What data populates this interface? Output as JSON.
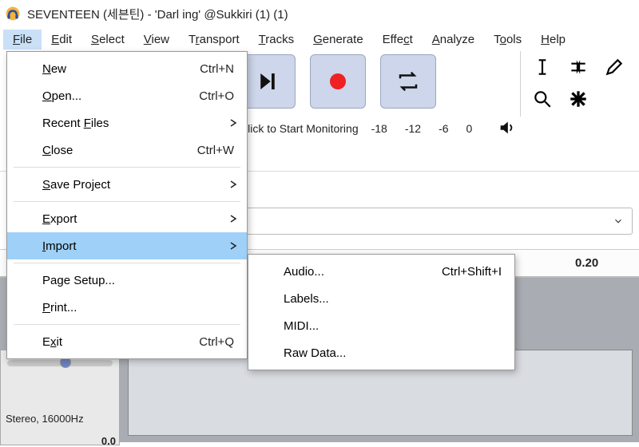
{
  "titlebar": {
    "title": "SEVENTEEN (세븐틴) - 'Darl ing' @Sukkiri (1) (1)"
  },
  "menubar": {
    "file": "File",
    "edit": "Edit",
    "select": "Select",
    "view": "View",
    "transport": "Transport",
    "tracks": "Tracks",
    "generate": "Generate",
    "effect": "Effect",
    "analyze": "Analyze",
    "tools": "Tools",
    "help": "Help"
  },
  "meter": {
    "click_text": "Click to Start Monitoring",
    "ticks": [
      "-18",
      "-12",
      "-6",
      "0"
    ]
  },
  "timeline": {
    "tick_020": "0.20"
  },
  "track": {
    "db_label": "0.0",
    "info": "Stereo, 16000Hz"
  },
  "file_menu": {
    "new": "New",
    "new_sc": "Ctrl+N",
    "open": "Open...",
    "open_sc": "Ctrl+O",
    "recent": "Recent Files",
    "close": "Close",
    "close_sc": "Ctrl+W",
    "save_project": "Save Project",
    "export": "Export",
    "import": "Import",
    "page_setup": "Page Setup...",
    "print": "Print...",
    "exit": "Exit",
    "exit_sc": "Ctrl+Q"
  },
  "import_menu": {
    "audio": "Audio...",
    "audio_sc": "Ctrl+Shift+I",
    "labels": "Labels...",
    "midi": "MIDI...",
    "raw": "Raw Data..."
  }
}
